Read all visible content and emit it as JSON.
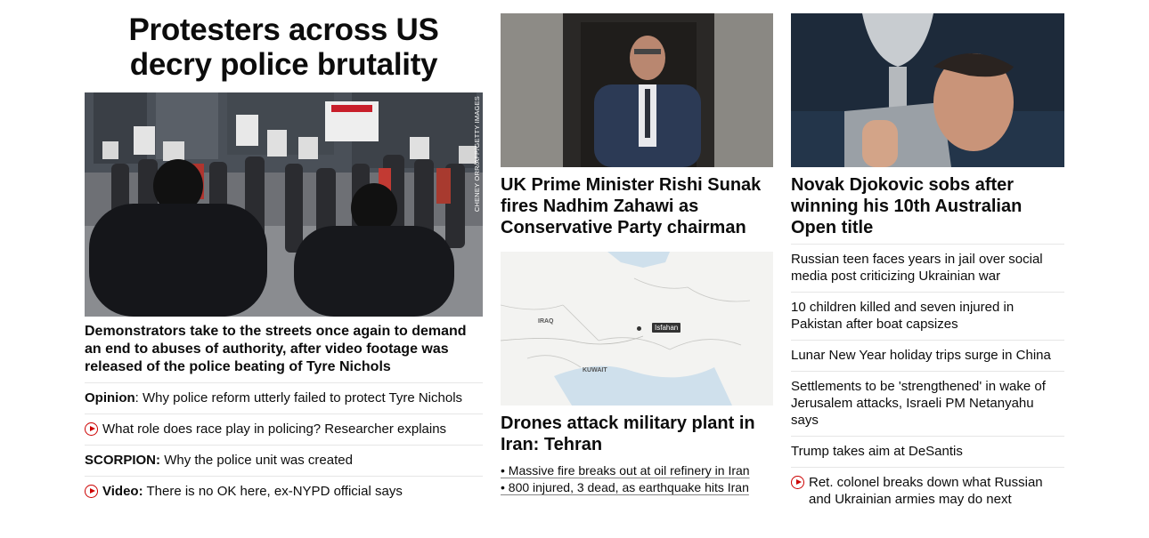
{
  "left": {
    "headline_line1": "Protesters across US",
    "headline_line2": "decry police brutality",
    "photo_credit": "CHENEY ORR/AFP/GETTY IMAGES",
    "lead": "Demonstrators take to the streets once again to demand an end to abuses of authority, after video footage was released of the police beating of Tyre Nichols",
    "items": [
      {
        "prefix": "Opinion",
        "suffix": ": ",
        "text": "Why police reform utterly failed to protect Tyre Nichols"
      },
      {
        "prefix": "",
        "suffix": "",
        "text": "What role does race play in policing? Researcher explains",
        "icon": "play-icon"
      },
      {
        "prefix": "SCORPION:",
        "suffix": " ",
        "text": "Why the police unit was created"
      },
      {
        "prefix": "Video:",
        "suffix": " ",
        "text": "There is no OK here, ex-NYPD official says",
        "icon": "play-icon"
      }
    ]
  },
  "middle": {
    "story1_title": "UK Prime Minister Rishi Sunak fires Nadhim Zahawi as Conservative Party chairman",
    "map_labels": {
      "iraq": "IRAQ",
      "kuwait": "KUWAIT",
      "isfahan": "Isfahan"
    },
    "story2_title": "Drones attack military plant in Iran: Tehran",
    "bullets": [
      "• Massive fire breaks out at oil refinery in Iran",
      "• 800 injured, 3 dead, as earthquake hits Iran"
    ]
  },
  "right": {
    "story_title": "Novak Djokovic sobs after winning his 10th Australian Open title",
    "items": [
      {
        "text": "Russian teen faces years in jail over social media post criticizing Ukrainian war"
      },
      {
        "text": "10 children killed and seven injured in Pakistan after boat capsizes"
      },
      {
        "text": "Lunar New Year holiday trips surge in China"
      },
      {
        "text": "Settlements to be 'strengthened' in wake of Jerusalem attacks, Israeli PM Netanyahu says"
      },
      {
        "text": "Trump takes aim at DeSantis"
      },
      {
        "text": "Ret. colonel breaks down what Russian and Ukrainian armies may do next",
        "icon": "play-icon"
      }
    ]
  },
  "colors": {
    "accent": "#cc0000",
    "divider": "#e6e6e6",
    "text": "#0c0c0c"
  }
}
